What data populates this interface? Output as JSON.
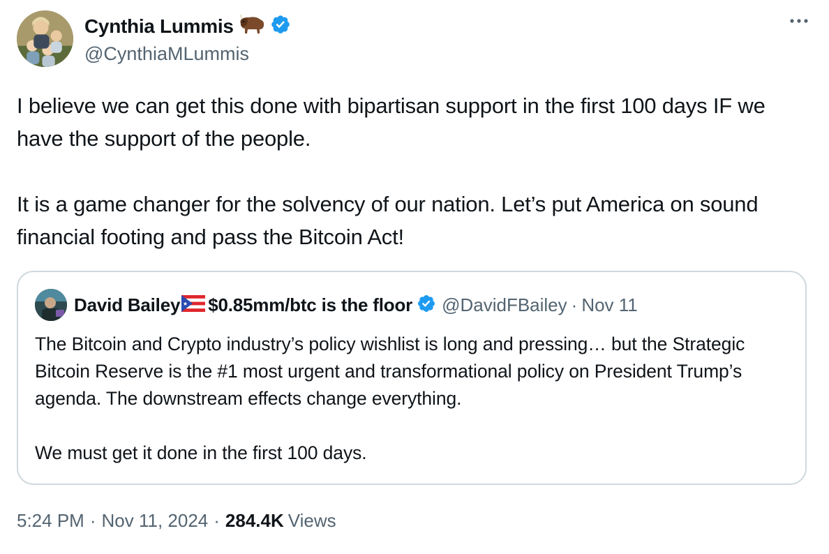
{
  "author": {
    "display_name": "Cynthia Lummis",
    "handle": "@CynthiaMLummis",
    "name_emoji": "bison-icon",
    "verified": true
  },
  "tweet": {
    "text": "I believe we can get this done with bipartisan support in the first 100 days IF we have the support of the people.\n\nIt is a game changer for the solvency of our nation. Let’s put America on sound financial footing and pass the Bitcoin Act!"
  },
  "quoted_tweet": {
    "display_name_prefix": "David Bailey",
    "flag_icon": "puerto-rico-flag-icon",
    "display_name_suffix": "$0.85mm/btc is the floor",
    "handle": "@DavidFBailey",
    "separator": "·",
    "date": "Nov 11",
    "verified": true,
    "text": "The Bitcoin and Crypto industry’s policy wishlist is long and pressing… but the Strategic Bitcoin Reserve is the #1 most urgent and transformational policy on President Trump’s agenda. The downstream effects change everything.\n\nWe must get it done in the first 100 days."
  },
  "footer": {
    "time": "5:24 PM",
    "separator": "·",
    "date": "Nov 11, 2024",
    "views_count": "284.4K",
    "views_label": "Views"
  },
  "colors": {
    "text": "#0f1419",
    "secondary": "#536471",
    "verified": "#1d9bf0",
    "border": "#cfd9de"
  }
}
